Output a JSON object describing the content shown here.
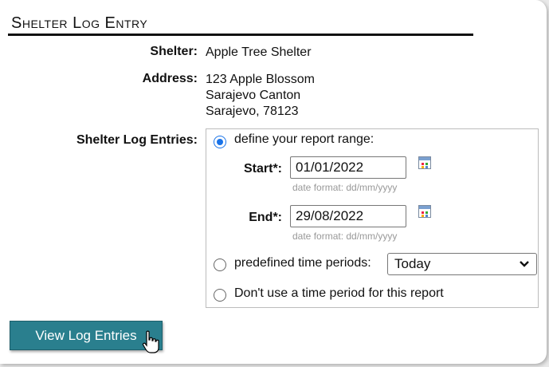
{
  "title": "Shelter Log Entry",
  "shelter": {
    "label": "Shelter:",
    "value": "Apple Tree Shelter"
  },
  "address": {
    "label": "Address:",
    "lines": [
      "123 Apple Blossom",
      "Sarajevo Canton",
      "Sarajevo, 78123"
    ]
  },
  "entries": {
    "label": "Shelter Log Entries:",
    "option_range": "define your report range:",
    "start": {
      "label": "Start*:",
      "value": "01/01/2022",
      "hint": "date format: dd/mm/yyyy"
    },
    "end": {
      "label": "End*:",
      "value": "29/08/2022",
      "hint": "date format: dd/mm/yyyy"
    },
    "option_predefined": "predefined time periods:",
    "predefined_selected": "Today",
    "option_none": "Don't use a time period for this report",
    "selected_option": "range"
  },
  "button": {
    "label": "View Log Entries"
  },
  "colors": {
    "button": "#2a7f8e",
    "radio_selected": "#1a73e8"
  }
}
